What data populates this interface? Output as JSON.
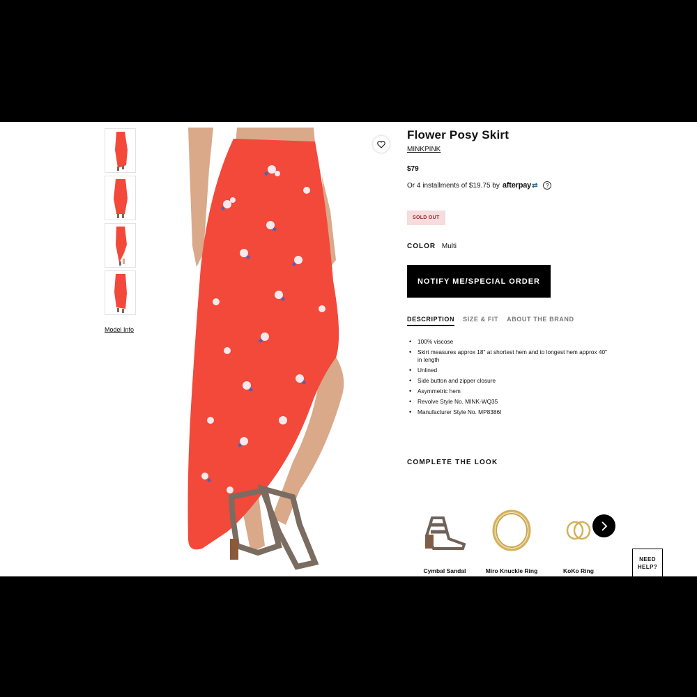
{
  "product": {
    "title": "Flower Posy Skirt",
    "brand": "MINKPINK",
    "price": "$79",
    "installments_text": "Or 4 installments of $19.75 by",
    "afterpay_logo": "afterpay",
    "afterpay_help": "?",
    "stock_badge": "SOLD OUT",
    "color_label": "COLOR",
    "color_value": "Multi",
    "notify_button": "NOTIFY ME/SPECIAL ORDER",
    "model_info": "Model Info"
  },
  "tabs": [
    {
      "label": "DESCRIPTION",
      "active": true
    },
    {
      "label": "SIZE & FIT",
      "active": false
    },
    {
      "label": "ABOUT THE BRAND",
      "active": false
    }
  ],
  "description": [
    "100% viscose",
    "Skirt measures approx 18\" at shortest hem and to longest hem approx 40\" in length",
    "Unlined",
    "Side button and zipper closure",
    "Asymmetric hem",
    "Revolve Style No. MINK-WQ35",
    "Manufacturer Style No. MP8386I"
  ],
  "complete_the_look": {
    "heading": "COMPLETE THE LOOK",
    "items": [
      {
        "name": "Cymbal Sandal",
        "icon": "sandal-icon"
      },
      {
        "name": "Miro Knuckle Ring",
        "icon": "ring-icon"
      },
      {
        "name": "KoKo Ring",
        "icon": "ring-icon"
      }
    ]
  },
  "chat": {
    "label_line1": "NEED",
    "label_line2": "HELP?"
  },
  "colors": {
    "skirt": "#f2493a",
    "sold_out_bg": "#f6dcdc",
    "sold_out_text": "#8d2a2a",
    "button": "#000000"
  }
}
